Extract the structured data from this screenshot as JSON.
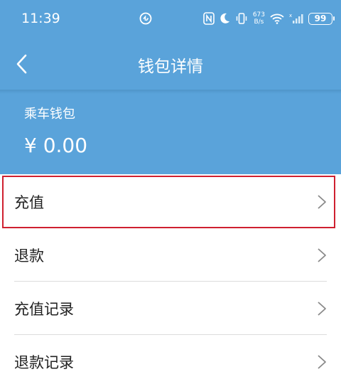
{
  "status_bar": {
    "time": "11:39",
    "net_speed_value": "673",
    "net_speed_unit": "B/s",
    "battery_level": "99",
    "icons": [
      "app-notification-icon",
      "nfc-icon",
      "moon-icon",
      "vibrate-icon",
      "wifi-icon",
      "signal-icon",
      "battery-icon"
    ]
  },
  "app_bar": {
    "title": "钱包详情",
    "back_icon": "chevron-left-icon"
  },
  "wallet": {
    "name": "乘车钱包",
    "balance": "¥ 0.00"
  },
  "menu": {
    "items": [
      {
        "label": "充值",
        "highlighted": true
      },
      {
        "label": "退款"
      },
      {
        "label": "充值记录"
      },
      {
        "label": "退款记录"
      }
    ],
    "chevron_icon": "chevron-right-icon"
  },
  "colors": {
    "header_bg": "#5aa3da",
    "highlight_border": "#cf2030",
    "text": "#222222",
    "divider": "#dcdcdc"
  }
}
